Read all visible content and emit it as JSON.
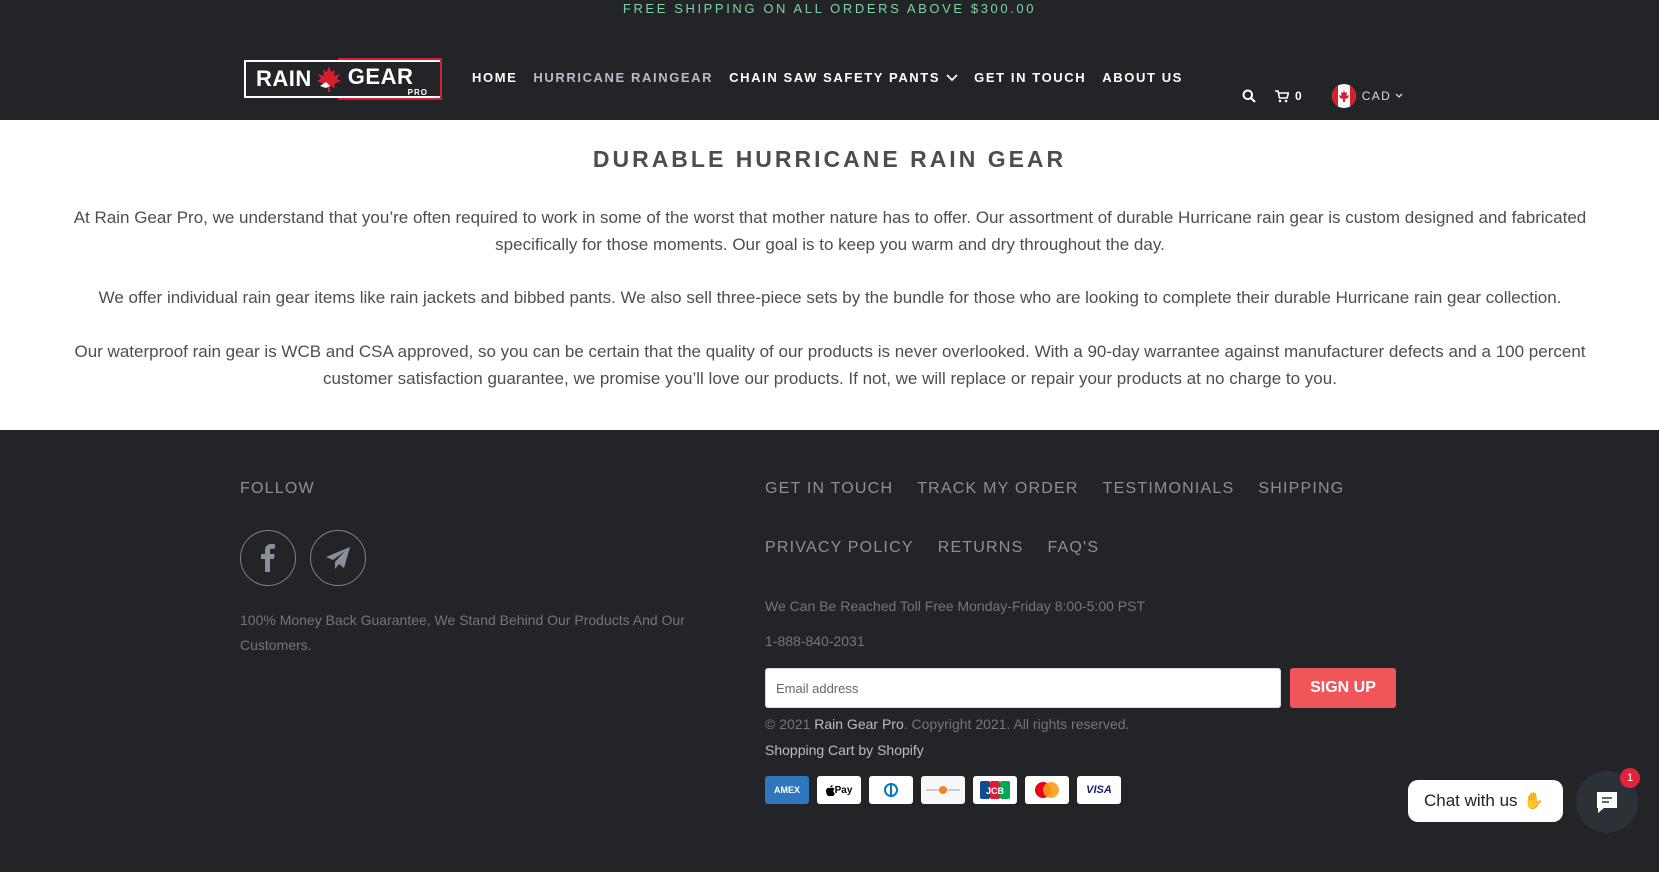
{
  "announcement": "FREE SHIPPING ON ALL ORDERS ABOVE $300.00",
  "logo": {
    "word1": "RAIN",
    "word2": "GEAR",
    "sub": "PRO"
  },
  "nav": {
    "items": [
      {
        "label": "HOME"
      },
      {
        "label": "HURRICANE RAINGEAR"
      },
      {
        "label": "CHAIN SAW SAFETY PANTS"
      },
      {
        "label": "GET IN TOUCH"
      },
      {
        "label": "ABOUT US"
      }
    ]
  },
  "header_right": {
    "cart_count": "0",
    "currency": "CAD"
  },
  "main": {
    "title": "DURABLE HURRICANE RAIN GEAR",
    "paragraphs": [
      "At Rain Gear Pro, we understand that you’re often required to work in some of the worst that mother nature has to offer. Our assortment of durable Hurricane rain gear is custom designed and fabricated specifically for those moments. Our goal is to keep you warm and dry throughout the day.",
      "We offer individual rain gear items like rain jackets and bibbed pants. We also sell three-piece sets by the bundle for those who are looking to complete their durable Hurricane rain gear collection.",
      "Our waterproof rain gear is WCB and CSA approved, so you can be certain that the quality of our products is never overlooked. With a 90-day warrantee against manufacturer defects and a 100 percent customer satisfaction guarantee, we promise you’ll love our products. If not, we will replace or repair your products at no charge to you."
    ]
  },
  "footer": {
    "follow_label": "FOLLOW",
    "guarantee": "100% Money Back Guarantee, We Stand Behind Our Products And Our Customers.",
    "links_row1": [
      "GET IN TOUCH",
      "TRACK MY ORDER",
      "TESTIMONIALS",
      "SHIPPING"
    ],
    "links_row2": [
      "PRIVACY POLICY",
      "RETURNS",
      "FAQ'S"
    ],
    "contact_hours": "We Can Be Reached Toll Free Monday-Friday 8:00-5:00 PST",
    "phone": "1-888-840-2031",
    "email_placeholder": "Email address",
    "signup_label": "SIGN UP",
    "copyright_prefix": "© 2021 ",
    "copyright_brand": "Rain Gear Pro",
    "copyright_suffix": ". Copyright 2021. All rights reserved.",
    "shopify": "Shopping Cart by Shopify",
    "payments": [
      {
        "name": "amex-icon",
        "label": "AMEX"
      },
      {
        "name": "apple-pay-icon",
        "label": " Pay"
      },
      {
        "name": "diners-club-icon",
        "label": ""
      },
      {
        "name": "discover-icon",
        "label": ""
      },
      {
        "name": "jcb-icon",
        "label": "JCB"
      },
      {
        "name": "mastercard-icon",
        "label": ""
      },
      {
        "name": "visa-icon",
        "label": "VISA"
      }
    ]
  },
  "chat": {
    "label": "Chat with us",
    "badge": "1"
  },
  "colors": {
    "accent_signup": "#f0555a",
    "announce_green": "#7fd3a0",
    "dark_bg": "#222428",
    "brand_red": "#d71f2b"
  }
}
